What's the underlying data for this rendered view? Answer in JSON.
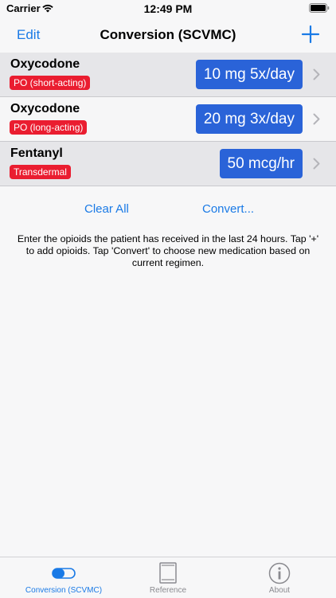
{
  "status_bar": {
    "carrier": "Carrier",
    "time": "12:49 PM"
  },
  "nav": {
    "edit_label": "Edit",
    "title": "Conversion (SCVMC)",
    "add_icon": "plus-icon"
  },
  "medications": [
    {
      "name": "Oxycodone",
      "route": "PO (short-acting)",
      "dose": "10 mg 5x/day"
    },
    {
      "name": "Oxycodone",
      "route": "PO (long-acting)",
      "dose": "20 mg 3x/day"
    },
    {
      "name": "Fentanyl",
      "route": "Transdermal",
      "dose": "50 mcg/hr"
    }
  ],
  "actions": {
    "clear_all_label": "Clear All",
    "convert_label": "Convert..."
  },
  "help_text": "Enter the opioids the patient has received in the last 24 hours. Tap '+' to add opioids. Tap 'Convert' to choose new medication based on current regimen.",
  "tabs": [
    {
      "label": "Conversion (SCVMC)",
      "icon": "toggle-icon",
      "active": true
    },
    {
      "label": "Reference",
      "icon": "book-icon",
      "active": false
    },
    {
      "label": "About",
      "icon": "info-icon",
      "active": false
    }
  ],
  "colors": {
    "accent": "#1a7ae6",
    "badge_red": "#ea1d30",
    "dose_blue": "#2a63d8"
  }
}
